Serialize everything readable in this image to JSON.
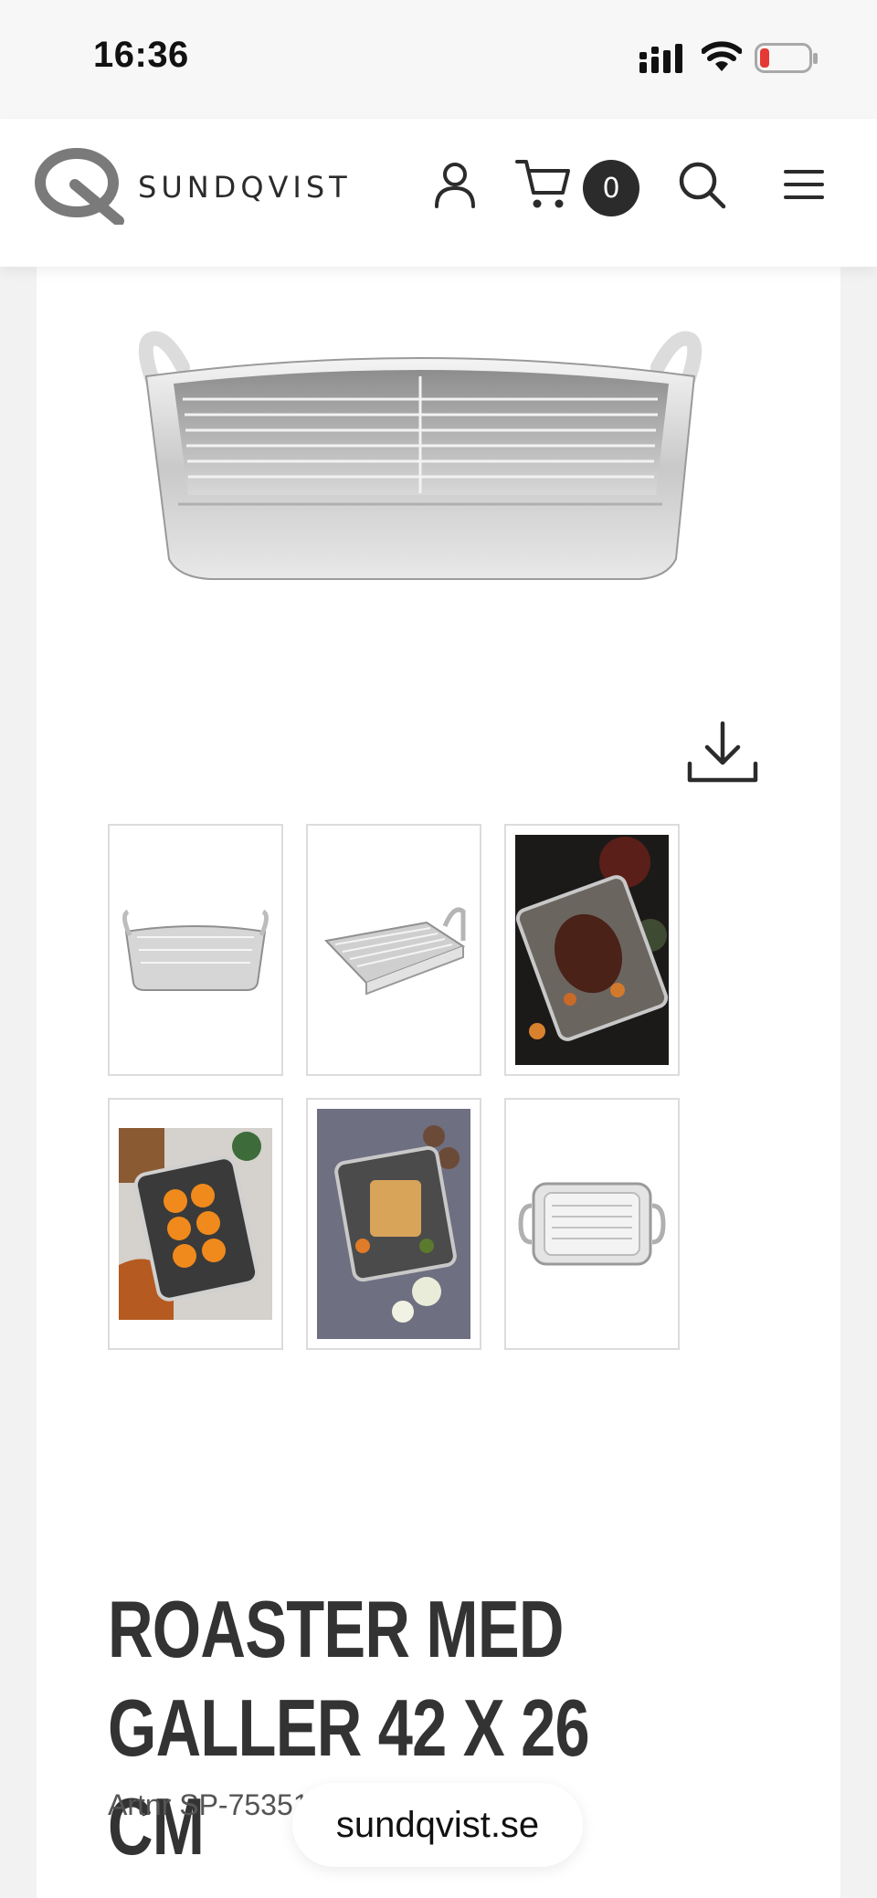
{
  "status_bar": {
    "time": "16:36",
    "icons": [
      "cellular-signal-icon",
      "wifi-icon",
      "battery-low-icon"
    ],
    "battery_color": "#e53935"
  },
  "header": {
    "brand": "SUNDQVIST",
    "icons": [
      "account-icon",
      "cart-icon",
      "search-icon",
      "menu-icon"
    ],
    "cart_count": "0"
  },
  "product": {
    "images": [
      "roaster-main-image",
      "thumb-1",
      "thumb-2",
      "thumb-3",
      "thumb-4",
      "thumb-5",
      "thumb-6"
    ],
    "download_icon": "download-icon",
    "title": "ROASTER MED GALLER 42 X 26 CM",
    "artnr": "Artnr SP-75351"
  },
  "browser": {
    "url": "sundqvist.se"
  },
  "colors": {
    "text_dark": "#2b2b2b",
    "page_bg": "#f2f2f2",
    "card_bg": "#ffffff",
    "thumb_border": "#dcdcdc"
  }
}
